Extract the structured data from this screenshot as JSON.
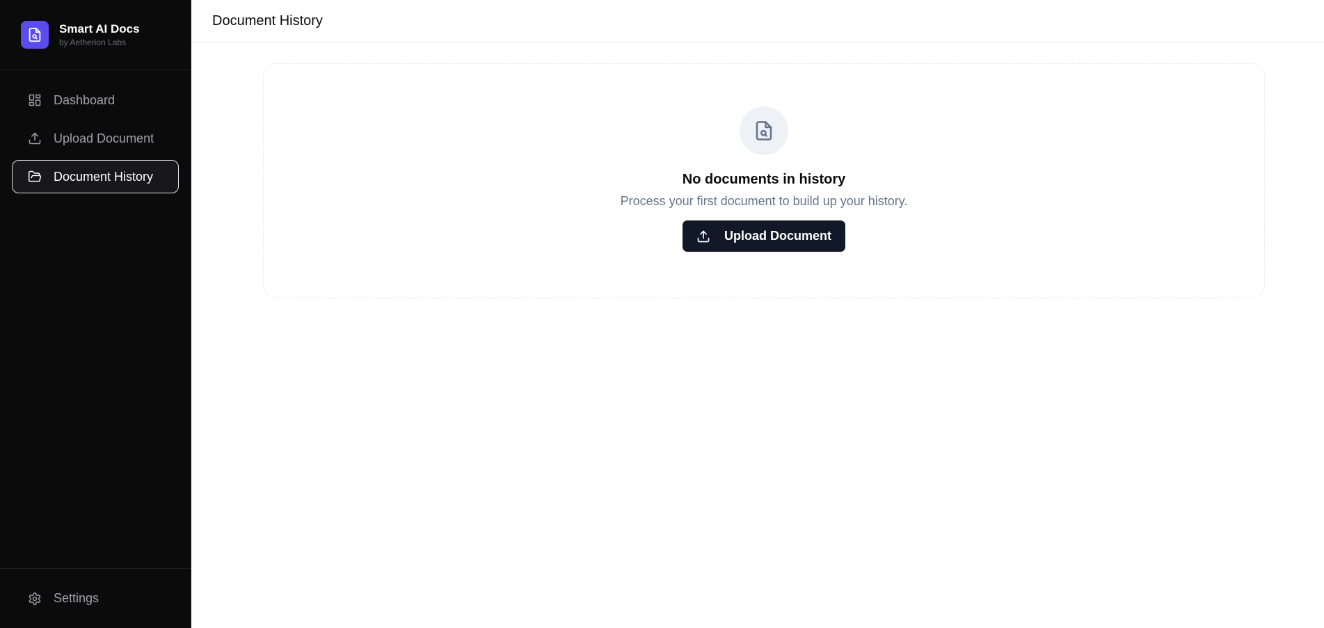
{
  "brand": {
    "title": "Smart AI Docs",
    "subtitle": "by Aetherion Labs",
    "logo_icon": "file-search-icon",
    "accent_color": "#5b4cf0"
  },
  "sidebar": {
    "items": [
      {
        "label": "Dashboard",
        "icon": "dashboard-grid-icon",
        "active": false
      },
      {
        "label": "Upload Document",
        "icon": "upload-icon",
        "active": false
      },
      {
        "label": "Document History",
        "icon": "folder-open-icon",
        "active": true
      }
    ],
    "footer": {
      "label": "Settings",
      "icon": "gear-icon"
    }
  },
  "header": {
    "title": "Document History"
  },
  "empty_state": {
    "icon": "file-search-icon",
    "title": "No documents in history",
    "description": "Process your first document to build up your history.",
    "button_label": "Upload Document",
    "button_icon": "upload-icon"
  }
}
